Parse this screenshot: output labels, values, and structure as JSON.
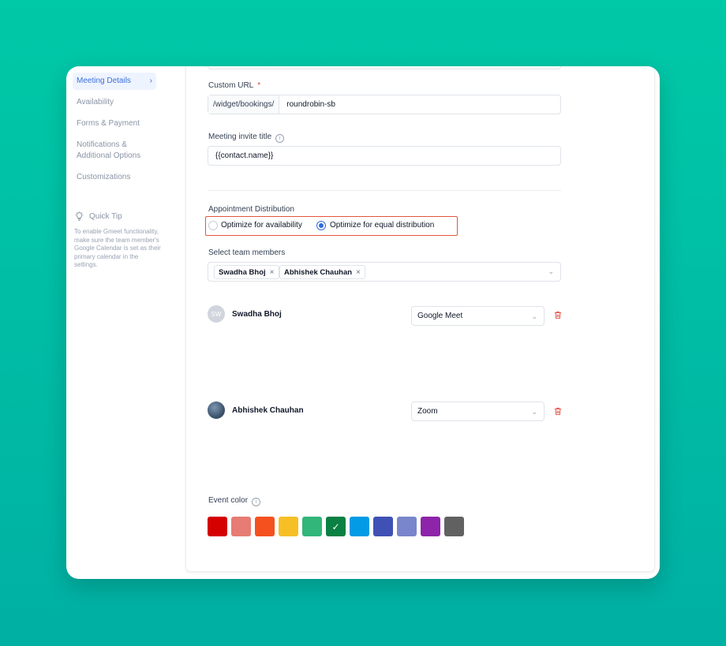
{
  "sidebar": {
    "items": [
      {
        "label": "Meeting Details",
        "active": true
      },
      {
        "label": "Availability"
      },
      {
        "label": "Forms & Payment"
      },
      {
        "label": "Notifications & Additional Options"
      },
      {
        "label": "Customizations"
      }
    ],
    "tip": {
      "title": "Quick Tip",
      "body": "To enable Gmeet functionality, make sure the team member's Google Calendar is set as their primary calendar in the settings."
    }
  },
  "form": {
    "custom_url": {
      "label": "Custom URL",
      "required_mark": "*",
      "prefix": "/widget/bookings/",
      "value": "roundrobin-sb"
    },
    "invite_title": {
      "label": "Meeting invite title",
      "value": "{{contact.name}}"
    },
    "distribution": {
      "label": "Appointment Distribution",
      "options": [
        {
          "label": "Optimize for availability",
          "selected": false
        },
        {
          "label": "Optimize for equal distribution",
          "selected": true
        }
      ]
    },
    "team": {
      "label": "Select team members",
      "tags": [
        "Swadha Bhoj",
        "Abhishek Chauhan"
      ],
      "members": [
        {
          "initials": "SW",
          "name": "Swadha Bhoj",
          "location": "Google Meet"
        },
        {
          "initials": "",
          "name": "Abhishek Chauhan",
          "location": "Zoom"
        }
      ]
    },
    "event_color": {
      "label": "Event color",
      "colors": [
        "#d50000",
        "#e67c73",
        "#f4511e",
        "#f6bf26",
        "#33b679",
        "#0b8043",
        "#039be5",
        "#3f51b5",
        "#7986cb",
        "#8e24aa",
        "#616161"
      ],
      "selected_index": 5
    }
  }
}
